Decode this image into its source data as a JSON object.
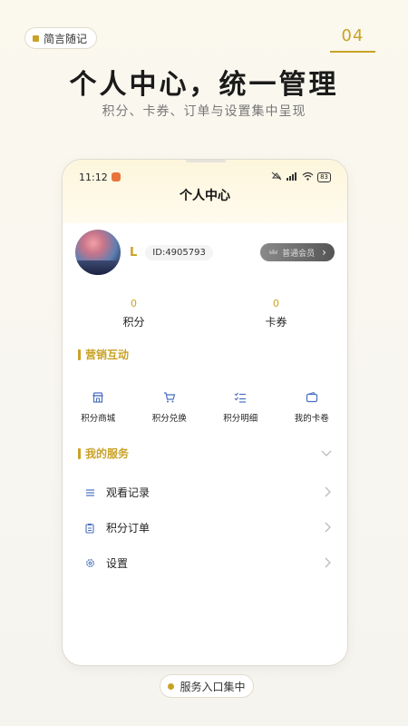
{
  "brand_tag": {
    "label": "简言随记"
  },
  "page_number": "04",
  "headline": "个人中心，统一管理",
  "subline": "积分、卡券、订单与设置集中呈现",
  "phone": {
    "status_bar": {
      "time": "11:12",
      "battery": "83"
    },
    "title": "个人中心",
    "profile": {
      "initial": "L",
      "id": "ID:4905793",
      "member_label": "普通会员"
    },
    "stats": [
      {
        "value": "0",
        "label": "积分"
      },
      {
        "value": "0",
        "label": "卡券"
      }
    ],
    "marketing": {
      "title": "营销互动",
      "items": [
        {
          "label": "积分商城",
          "icon": "store-icon"
        },
        {
          "label": "积分兑换",
          "icon": "cart-icon"
        },
        {
          "label": "积分明细",
          "icon": "checklist-icon"
        },
        {
          "label": "我的卡卷",
          "icon": "wallet-icon"
        }
      ]
    },
    "services": {
      "title": "我的服务",
      "items": [
        {
          "label": "观看记录",
          "icon": "list-icon"
        },
        {
          "label": "积分订单",
          "icon": "clipboard-icon"
        },
        {
          "label": "设置",
          "icon": "gear-icon"
        }
      ]
    }
  },
  "bottom_pill": {
    "label": "服务入口集中"
  },
  "colors": {
    "accent": "#c9a227",
    "icon_blue": "#4a6fbf"
  }
}
